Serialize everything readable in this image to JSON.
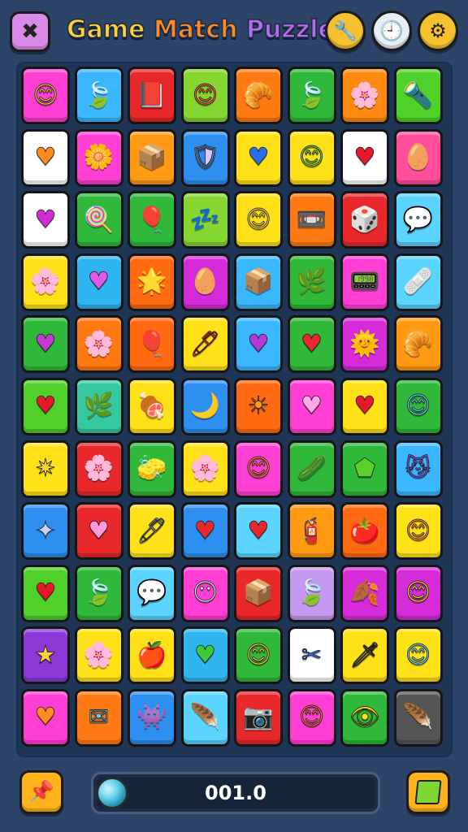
{
  "header": {
    "title_part1": "Game",
    "title_part2": "Match",
    "title_part3": "Puzzle",
    "left_button_icon": "crossed-sword-icon",
    "right_buttons": [
      {
        "name": "wrench-icon",
        "glyph": "🔧",
        "color": "#f6c12f"
      },
      {
        "name": "clock-icon",
        "glyph": "🕘",
        "color": "#e8eef5"
      },
      {
        "name": "gear-icon",
        "glyph": "⚙",
        "color": "#f6c12f"
      }
    ]
  },
  "board": {
    "rows": [
      [
        [
          "#ff3fd4",
          "#ffd23a",
          "😊"
        ],
        [
          "#3ab7ff",
          "#ffe36a",
          "🍃"
        ],
        [
          "#e8282b",
          "#8b4a1e",
          "📕"
        ],
        [
          "#86d632",
          "#ff5a1a",
          "😊"
        ],
        [
          "#ff7a12",
          "#e8c39a",
          "🥐"
        ],
        [
          "#2fb83a",
          "#7fd66a",
          "🍃"
        ],
        [
          "#ff8a12",
          "#ffffff",
          "🌸"
        ],
        [
          "#4fd12a",
          "#5bd5ff",
          "🔦"
        ]
      ],
      [
        [
          "#ffffff",
          "#ff8a1e",
          "♥"
        ],
        [
          "#ff3fd4",
          "#ffd23a",
          "🌼"
        ],
        [
          "#ff9a12",
          "#ffe36a",
          "📦"
        ],
        [
          "#2d8ff0",
          "#e0c6ff",
          "🛡"
        ],
        [
          "#ffe11a",
          "#2e6cf0",
          "♥"
        ],
        [
          "#ffe11a",
          "#5ad12a",
          "😊"
        ],
        [
          "#ffffff",
          "#e8182b",
          "♥"
        ],
        [
          "#ff4f9a",
          "#ff6a2a",
          "🥚"
        ]
      ],
      [
        [
          "#ffffff",
          "#d52bd8",
          "♥"
        ],
        [
          "#2fb83a",
          "#e24a8a",
          "🍭"
        ],
        [
          "#2fb83a",
          "#d83fae",
          "🎈"
        ],
        [
          "#86d632",
          "#c43ad0",
          "💤"
        ],
        [
          "#ffe11a",
          "#ffd23a",
          "😊"
        ],
        [
          "#ff7a12",
          "#555555",
          "📼"
        ],
        [
          "#e8282b",
          "#9a8f8a",
          "🎲"
        ],
        [
          "#5bd5ff",
          "#ffe36a",
          "💬"
        ]
      ],
      [
        [
          "#ffe11a",
          "#d83fd4",
          "🌸"
        ],
        [
          "#2fb6f0",
          "#e05ae8",
          "♥"
        ],
        [
          "#ff6a12",
          "#ffd23a",
          "🌟"
        ],
        [
          "#d52bd8",
          "#ffb21a",
          "🥚"
        ],
        [
          "#3ab7ff",
          "#ffe8b0",
          "📦"
        ],
        [
          "#2fb83a",
          "#3a8a2a",
          "🌿"
        ],
        [
          "#ff3fd4",
          "#f0e0f5",
          "📟"
        ],
        [
          "#5bd5ff",
          "#ffb23a",
          "🩹"
        ]
      ],
      [
        [
          "#2fb83a",
          "#c43ad0",
          "♥"
        ],
        [
          "#ff7a12",
          "#3a6fd8",
          "🌸"
        ],
        [
          "#ff6a12",
          "#3ec83a",
          "🎈"
        ],
        [
          "#ffe11a",
          "#e8282b",
          "🖊"
        ],
        [
          "#3ab7ff",
          "#b23ad8",
          "♥"
        ],
        [
          "#2fb83a",
          "#e8282b",
          "♥"
        ],
        [
          "#d52bd8",
          "#ffd23a",
          "🌞"
        ],
        [
          "#ff9a12",
          "#e8c39a",
          "🥐"
        ]
      ],
      [
        [
          "#4fd12a",
          "#e8182b",
          "♥"
        ],
        [
          "#36c9a0",
          "#3a9a2a",
          "🌿"
        ],
        [
          "#ffe11a",
          "#e8282b",
          "🍖"
        ],
        [
          "#2d8ff0",
          "#ffe36a",
          "🌙"
        ],
        [
          "#ff6a12",
          "#ff9a1a",
          "☀"
        ],
        [
          "#ff3fd4",
          "#ffa8e8",
          "♥"
        ],
        [
          "#ffe11a",
          "#e8182b",
          "♥"
        ],
        [
          "#2fb83a",
          "#5bd5ff",
          "😊"
        ]
      ],
      [
        [
          "#ffe11a",
          "#ffd23a",
          "✷"
        ],
        [
          "#e8282b",
          "#c46ad0",
          "🌸"
        ],
        [
          "#2fb83a",
          "#ffe11a",
          "🧽"
        ],
        [
          "#ffe11a",
          "#e06ad8",
          "🌸"
        ],
        [
          "#ff3fd4",
          "#ff8a2a",
          "😊"
        ],
        [
          "#2fb83a",
          "#56c032",
          "🥒"
        ],
        [
          "#2fb83a",
          "#5ad12a",
          "⬟"
        ],
        [
          "#3ab7ff",
          "#8a4ad8",
          "😼"
        ]
      ],
      [
        [
          "#2d8ff0",
          "#c8d0ff",
          "✦"
        ],
        [
          "#e8282b",
          "#ff9ad8",
          "♥"
        ],
        [
          "#ffe11a",
          "#888888",
          "🖊"
        ],
        [
          "#2d8ff0",
          "#e8282b",
          "♥"
        ],
        [
          "#5bd5ff",
          "#e8282b",
          "♥"
        ],
        [
          "#ff9a12",
          "#b0b0b0",
          "🧯"
        ],
        [
          "#ff6a12",
          "#e8282b",
          "🍅"
        ],
        [
          "#ffe11a",
          "#ff8a1a",
          "😊"
        ]
      ],
      [
        [
          "#4fd12a",
          "#e8182b",
          "♥"
        ],
        [
          "#2fb83a",
          "#56c032",
          "🍃"
        ],
        [
          "#5bd5ff",
          "#5ad12a",
          "💬"
        ],
        [
          "#ff3fd4",
          "#f0f0ff",
          "😶"
        ],
        [
          "#e8282b",
          "#c86a3a",
          "📦"
        ],
        [
          "#c49af0",
          "#7fd5ff",
          "🍃"
        ],
        [
          "#d52bd8",
          "#ffb21a",
          "🍂"
        ],
        [
          "#d52bd8",
          "#ffe11a",
          "😊"
        ]
      ],
      [
        [
          "#8a3ad8",
          "#ffd23a",
          "★"
        ],
        [
          "#ffe11a",
          "#ff6ad8",
          "🌸"
        ],
        [
          "#ffe11a",
          "#e8282b",
          "🍎"
        ],
        [
          "#2fb6f0",
          "#3ec83a",
          "♥"
        ],
        [
          "#2fb83a",
          "#ffd23a",
          "😊"
        ],
        [
          "#ffffff",
          "#2e6cf0",
          "✂"
        ],
        [
          "#ffe11a",
          "#777777",
          "🗡"
        ],
        [
          "#ffe11a",
          "#5bd5ff",
          "😊"
        ]
      ],
      [
        [
          "#ff3fd4",
          "#ff8a1e",
          "♥"
        ],
        [
          "#ff7a12",
          "#5bd5ff",
          "✉"
        ],
        [
          "#2d8ff0",
          "#b03ad8",
          "👾"
        ],
        [
          "#5bd5ff",
          "#b03ad8",
          "🪶"
        ],
        [
          "#e8282b",
          "#dddddd",
          "📷"
        ],
        [
          "#ff3fd4",
          "#ff6a2a",
          "😊"
        ],
        [
          "#2fb83a",
          "#ffe11a",
          "👁"
        ],
        [
          "#555555",
          "#5bd5ff",
          "🪶"
        ]
      ]
    ]
  },
  "footer": {
    "score_text": "001.0",
    "progress_fraction": 1.0,
    "left_button_icon": "pin-icon",
    "right_button_icon": "green-square-icon"
  }
}
